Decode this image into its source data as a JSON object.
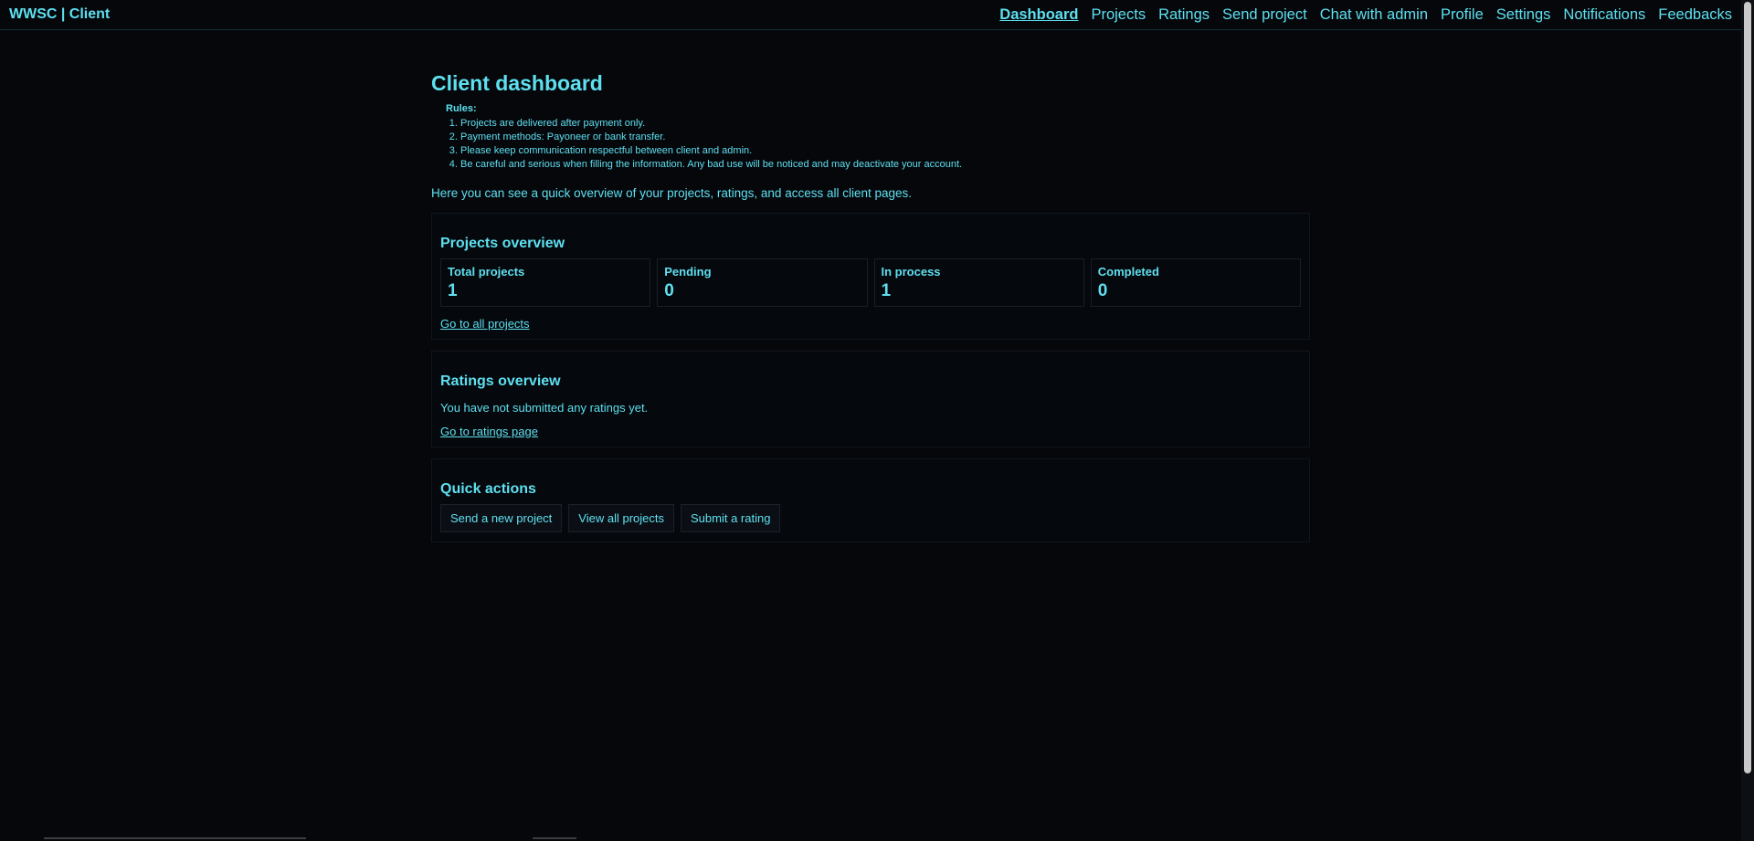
{
  "header": {
    "brand": "WWSC | Client",
    "nav": [
      {
        "label": "Dashboard",
        "active": true
      },
      {
        "label": "Projects"
      },
      {
        "label": "Ratings"
      },
      {
        "label": "Send project"
      },
      {
        "label": "Chat with admin"
      },
      {
        "label": "Profile"
      },
      {
        "label": "Settings"
      },
      {
        "label": "Notifications"
      },
      {
        "label": "Feedbacks"
      }
    ]
  },
  "main": {
    "title": "Client dashboard",
    "rules_title": "Rules:",
    "rules": [
      "Projects are delivered after payment only.",
      "Payment methods: Payoneer or bank transfer.",
      "Please keep communication respectful between client and admin.",
      "Be careful and serious when filling the information. Any bad use will be noticed and may deactivate your account."
    ],
    "intro": "Here you can see a quick overview of your projects, ratings, and access all client pages.",
    "projects": {
      "title": "Projects overview",
      "stats": [
        {
          "label": "Total projects",
          "value": "1"
        },
        {
          "label": "Pending",
          "value": "0"
        },
        {
          "label": "In process",
          "value": "1"
        },
        {
          "label": "Completed",
          "value": "0"
        }
      ],
      "link": "Go to all projects"
    },
    "ratings": {
      "title": "Ratings overview",
      "text": "You have not submitted any ratings yet.",
      "link": "Go to ratings page"
    },
    "quick_actions": {
      "title": "Quick actions",
      "buttons": [
        "Send a new project",
        "View all projects",
        "Submit a rating"
      ]
    }
  },
  "colors": {
    "background": "#05070b",
    "accent": "#5ee0f0"
  }
}
